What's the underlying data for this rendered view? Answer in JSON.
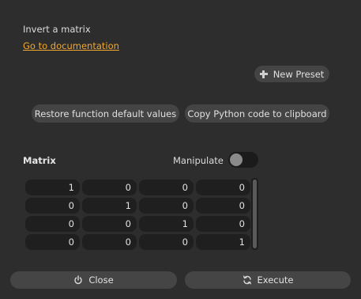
{
  "description": "Invert a matrix",
  "doc_link": "Go to documentation",
  "presets": {
    "new_preset_label": "New Preset"
  },
  "actions": {
    "restore_label": "Restore function default values",
    "copy_label": "Copy Python code to clipboard"
  },
  "matrix": {
    "label": "Matrix",
    "manipulate_label": "Manipulate",
    "manipulate_on": false,
    "rows": [
      [
        "1",
        "0",
        "0",
        "0"
      ],
      [
        "0",
        "1",
        "0",
        "0"
      ],
      [
        "0",
        "0",
        "1",
        "0"
      ],
      [
        "0",
        "0",
        "0",
        "1"
      ]
    ]
  },
  "footer": {
    "close_label": "Close",
    "execute_label": "Execute"
  },
  "colors": {
    "background": "#2d2d2d",
    "link": "#f0a830",
    "button": "#444444",
    "cell": "#1f1f1f"
  }
}
